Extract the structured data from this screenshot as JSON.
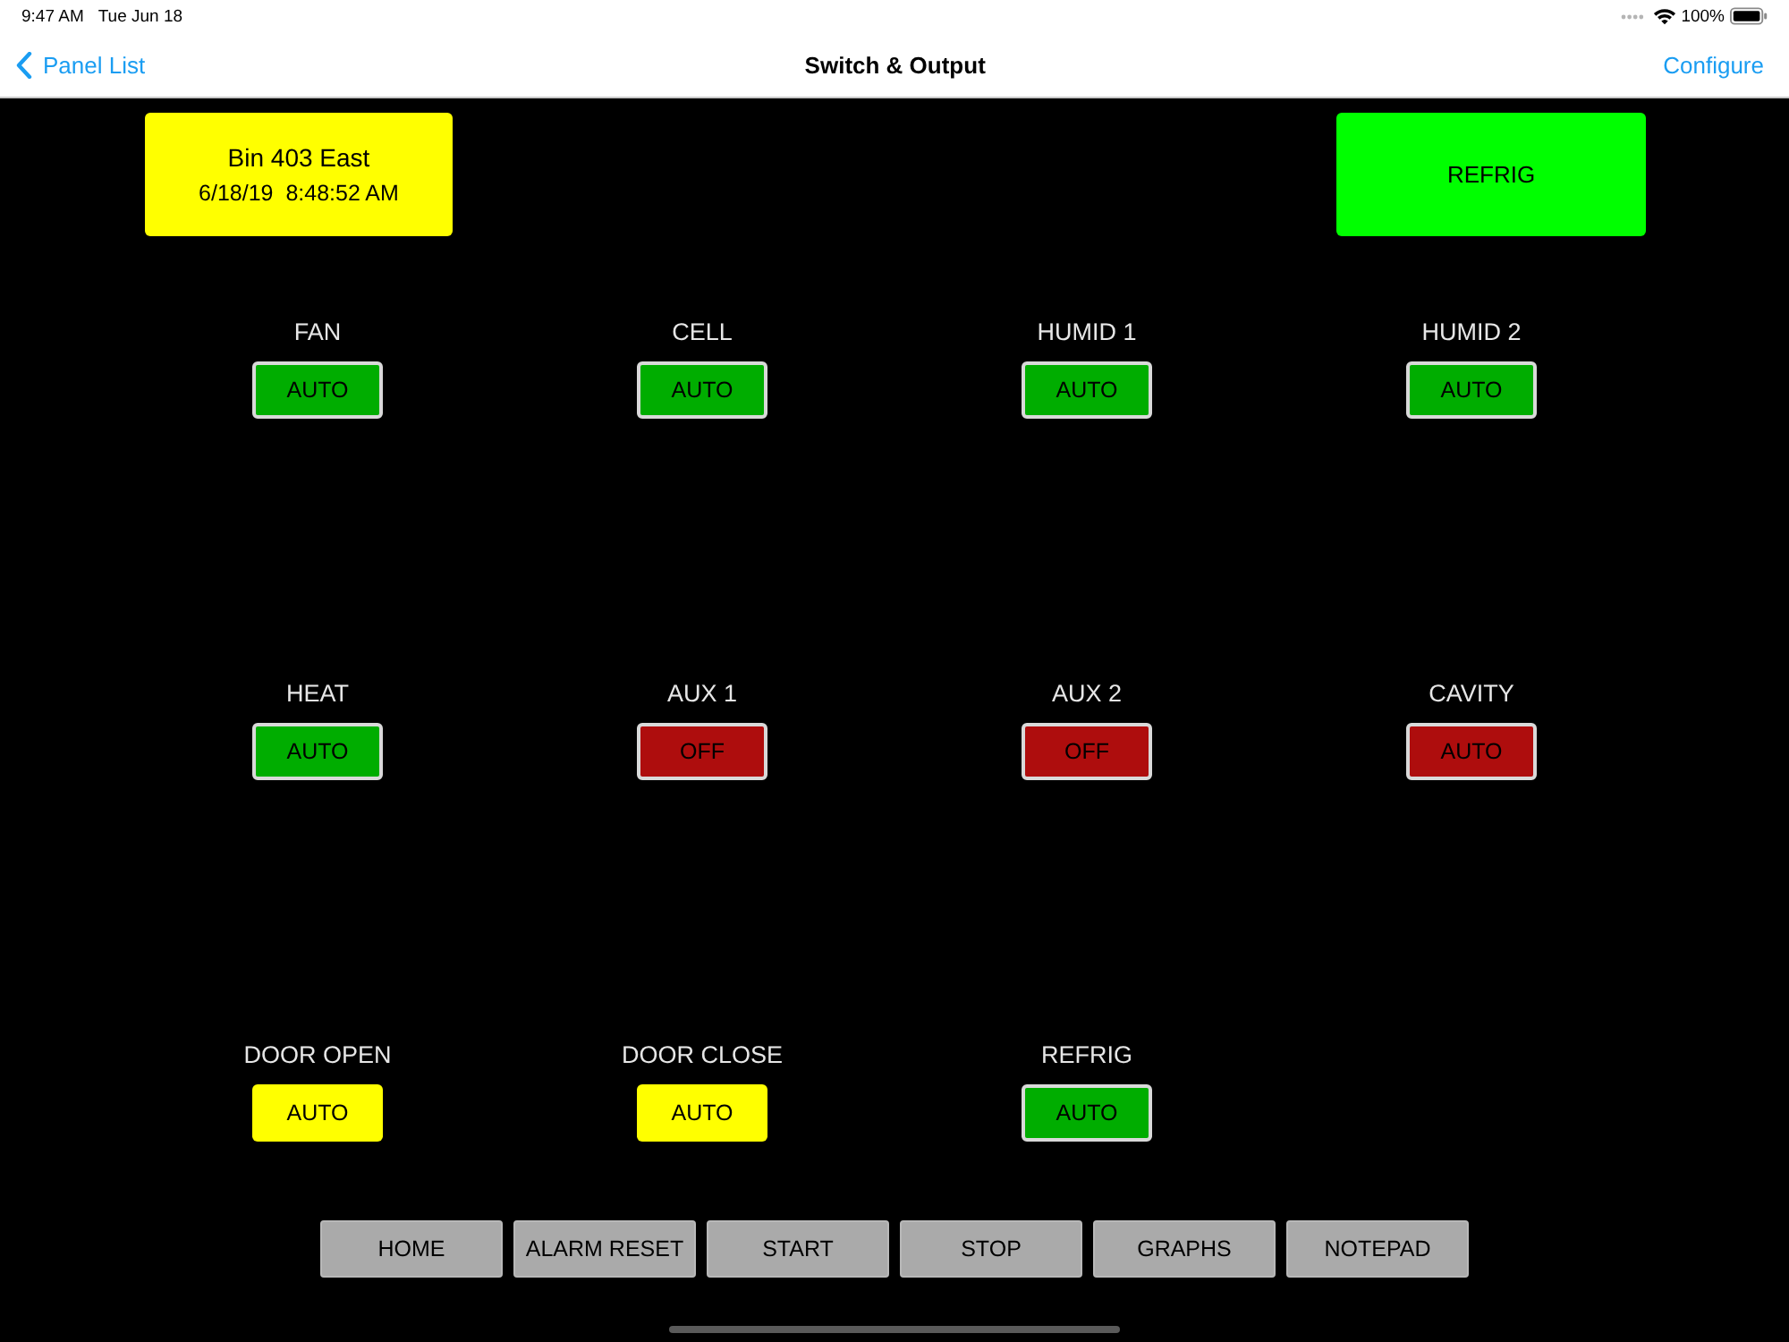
{
  "status_bar": {
    "time": "9:47 AM",
    "date": "Tue Jun 18",
    "battery": "100%"
  },
  "nav_bar": {
    "back": "Panel List",
    "title": "Switch & Output",
    "action": "Configure"
  },
  "info_panel": {
    "name": "Bin 403 East",
    "timestamp": "6/18/19  8:48:52 AM"
  },
  "mode_indicator": {
    "label": "REFRIG"
  },
  "outputs": [
    {
      "label": "FAN",
      "value": "AUTO",
      "color": "#00ad00",
      "outlined": true
    },
    {
      "label": "CELL",
      "value": "AUTO",
      "color": "#00ad00",
      "outlined": true
    },
    {
      "label": "HUMID 1",
      "value": "AUTO",
      "color": "#00ad00",
      "outlined": true
    },
    {
      "label": "HUMID 2",
      "value": "AUTO",
      "color": "#00ad00",
      "outlined": true
    },
    {
      "label": "HEAT",
      "value": "AUTO",
      "color": "#00ad00",
      "outlined": true
    },
    {
      "label": "AUX 1",
      "value": "OFF",
      "color": "#ae0d0d",
      "outlined": true
    },
    {
      "label": "AUX 2",
      "value": "OFF",
      "color": "#ae0d0d",
      "outlined": true
    },
    {
      "label": "CAVITY",
      "value": "AUTO",
      "color": "#ae0d0d",
      "outlined": true
    },
    {
      "label": "DOOR OPEN",
      "value": "AUTO",
      "color": "#ffff00",
      "outlined": false
    },
    {
      "label": "DOOR CLOSE",
      "value": "AUTO",
      "color": "#ffff00",
      "outlined": false
    },
    {
      "label": "REFRIG",
      "value": "AUTO",
      "color": "#00ad00",
      "outlined": true
    }
  ],
  "bottom_buttons": [
    "HOME",
    "ALARM RESET",
    "START",
    "STOP",
    "GRAPHS",
    "NOTEPAD"
  ]
}
